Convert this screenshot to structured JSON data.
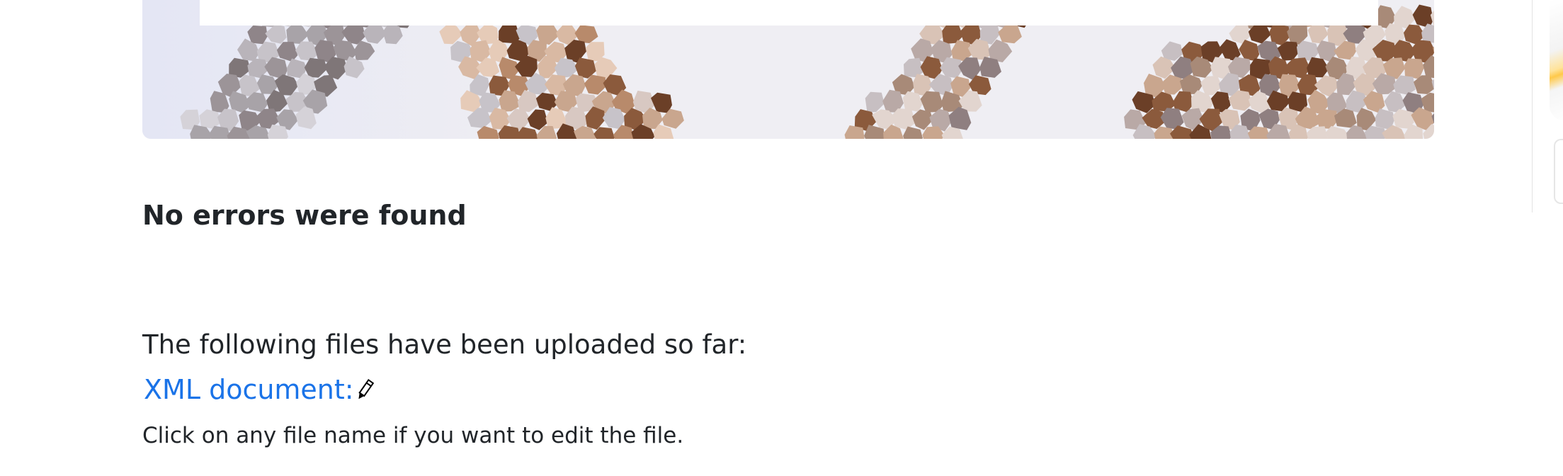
{
  "banner": {
    "colors": {
      "base": "#ebeaef",
      "grey": "#a8a3a8",
      "dark_grey": "#7f7678",
      "tan": "#c9a68e",
      "brown": "#8b5a3c",
      "dark_brown": "#6b3f27"
    }
  },
  "main": {
    "status_heading": "No errors were found",
    "uploaded_intro": "The following files have been uploaded so far:",
    "files": [
      {
        "label": "XML document:",
        "icon": "pencil-icon"
      }
    ],
    "hint": "Click on any file name if you want to edit the file."
  },
  "colors": {
    "link": "#1a73e8",
    "text": "#212529"
  }
}
